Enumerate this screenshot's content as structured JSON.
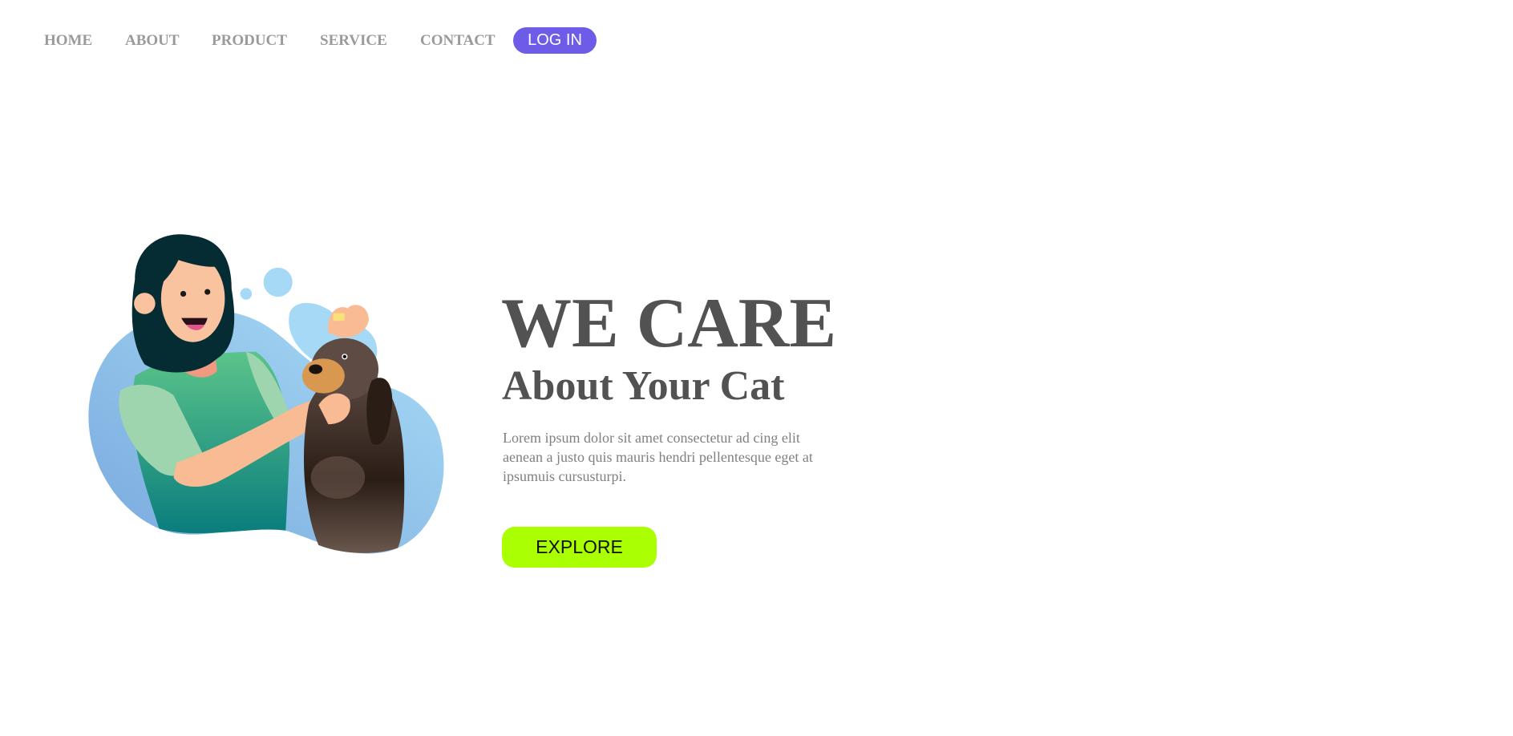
{
  "nav": {
    "items": [
      {
        "label": "HOME"
      },
      {
        "label": "ABOUT"
      },
      {
        "label": "PRODUCT"
      },
      {
        "label": "SERVICE"
      },
      {
        "label": "CONTACT"
      }
    ],
    "login_label": "LOG IN"
  },
  "hero": {
    "title": "WE CARE",
    "subtitle": "About Your Cat",
    "description": "Lorem ipsum dolor sit amet consectetur ad cing elit aenean a justo quis mauris hendri pellentesque eget at ipsumuis cursusturpi.",
    "explore_label": "EXPLORE"
  },
  "colors": {
    "login_bg": "#6c5ce7",
    "explore_bg": "#aaff00",
    "heading": "#525252",
    "nav_text": "#9a9a9a"
  }
}
